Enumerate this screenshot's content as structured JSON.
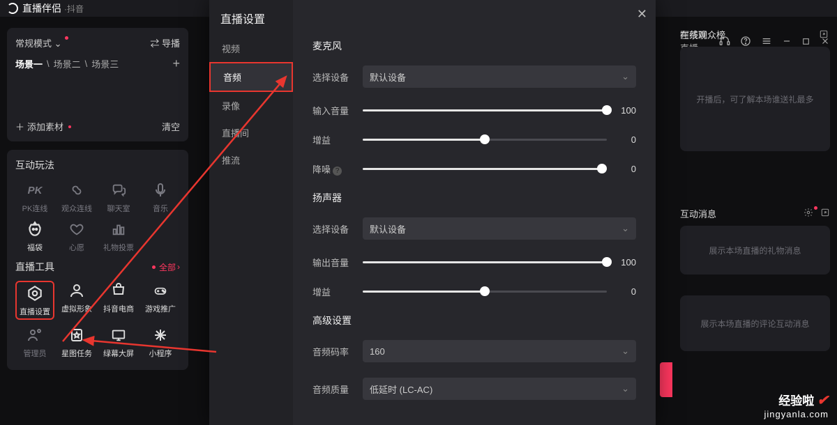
{
  "titlebar": {
    "title": "直播伴侣",
    "sub": "·抖音",
    "rightName": "阿茶聊直播"
  },
  "left": {
    "mode": "常规模式",
    "director": "导播",
    "scenes": [
      "场景一",
      "场景二",
      "场景三"
    ],
    "addMaterial": "添加素材",
    "clear": "清空",
    "interactTitle": "互动玩法",
    "interactIcons": [
      {
        "key": "pk",
        "label": "PK连线",
        "glyph": "PK"
      },
      {
        "key": "audience",
        "label": "观众连线"
      },
      {
        "key": "chatroom",
        "label": "聊天室"
      },
      {
        "key": "music",
        "label": "音乐"
      },
      {
        "key": "lucky",
        "label": "福袋"
      },
      {
        "key": "wish",
        "label": "心愿"
      },
      {
        "key": "gift",
        "label": "礼物投票"
      }
    ],
    "toolsTitle": "直播工具",
    "allLabel": "全部",
    "tools": [
      {
        "key": "settings",
        "label": "直播设置"
      },
      {
        "key": "avatar",
        "label": "虚拟形象"
      },
      {
        "key": "ecom",
        "label": "抖音电商"
      },
      {
        "key": "game",
        "label": "游戏推广"
      },
      {
        "key": "admin",
        "label": "管理员"
      },
      {
        "key": "star",
        "label": "星图任务"
      },
      {
        "key": "green",
        "label": "绿幕大屏"
      },
      {
        "key": "mini",
        "label": "小程序"
      }
    ]
  },
  "right": {
    "rank": {
      "title": "在线观众榜",
      "placeholder": "开播后，可了解本场谁送礼最多"
    },
    "msg": {
      "title": "互动消息",
      "placeholder": "展示本场直播的礼物消息",
      "placeholder2": "展示本场直播的评论互动消息"
    }
  },
  "modal": {
    "title": "直播设置",
    "tabs": [
      "视频",
      "音频",
      "录像",
      "直播间",
      "推流"
    ],
    "mic": {
      "header": "麦克风",
      "deviceLabel": "选择设备",
      "device": "默认设备",
      "inVolLabel": "输入音量",
      "inVol": 100,
      "gainLabel": "增益",
      "gain": 0,
      "gainPercent": 50,
      "noiseLabel": "降噪",
      "noise": 0,
      "noisePercent": 98
    },
    "spk": {
      "header": "扬声器",
      "deviceLabel": "选择设备",
      "device": "默认设备",
      "outVolLabel": "输出音量",
      "outVol": 100,
      "gainLabel": "增益",
      "gain": 0,
      "gainPercent": 50
    },
    "adv": {
      "header": "高级设置",
      "bitrateLabel": "音频码率",
      "bitrate": "160",
      "qualityLabel": "音频质量",
      "quality": "低延时 (LC-AC)"
    }
  },
  "watermark": {
    "line1": "经验啦",
    "line2": "jingyanla.com"
  }
}
